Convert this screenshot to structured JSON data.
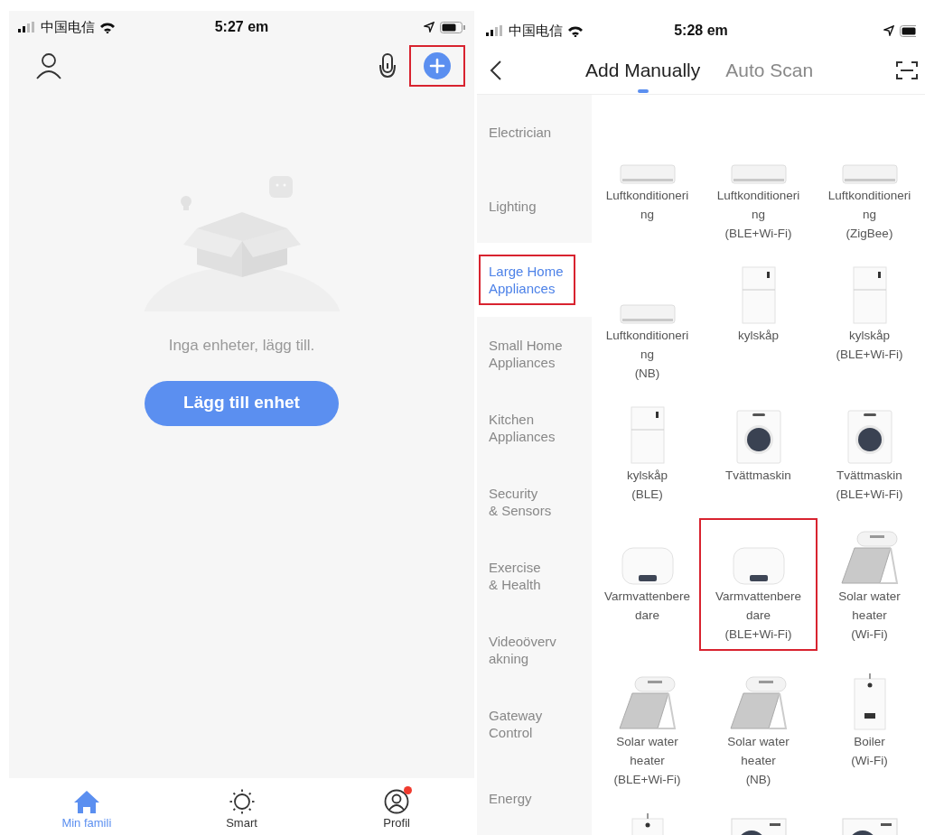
{
  "home_screen": {
    "status_bar": {
      "carrier": "中国电信",
      "time": "5:27 em"
    },
    "header": {
      "add_button_highlighted": true
    },
    "empty_state": {
      "message": "Inga enheter, lägg till.",
      "button": "Lägg till enhet"
    },
    "tab_bar": [
      {
        "kind": "home",
        "label": "Min famili",
        "selected": true,
        "badge": false
      },
      {
        "kind": "sun",
        "label": "Smart",
        "selected": false,
        "badge": false
      },
      {
        "kind": "profile",
        "label": "Profil",
        "selected": false,
        "badge": true
      }
    ]
  },
  "add_device_screen": {
    "status_bar": {
      "carrier": "中国电信",
      "time": "5:28 em"
    },
    "tabs": [
      {
        "label": "Add Manually",
        "selected": true
      },
      {
        "label": "Auto Scan",
        "selected": false
      }
    ],
    "categories": [
      {
        "label": "Electrician",
        "selected": false,
        "highlighted": false
      },
      {
        "label": "Lighting",
        "selected": false,
        "highlighted": false
      },
      {
        "label": "Large Home\nAppliances",
        "selected": true,
        "highlighted": true
      },
      {
        "label": "Small Home\nAppliances",
        "selected": false,
        "highlighted": false
      },
      {
        "label": "Kitchen\nAppliances",
        "selected": false,
        "highlighted": false
      },
      {
        "label": "Security\n& Sensors",
        "selected": false,
        "highlighted": false
      },
      {
        "label": "Exercise\n& Health",
        "selected": false,
        "highlighted": false
      },
      {
        "label": "Videoöverv\nakning",
        "selected": false,
        "highlighted": false
      },
      {
        "label": "Gateway\nControl",
        "selected": false,
        "highlighted": false
      },
      {
        "label": "Energy",
        "selected": false,
        "highlighted": false
      }
    ],
    "devices": [
      {
        "kind": "ac",
        "label": "Luftkonditioneri\nng",
        "highlighted": false
      },
      {
        "kind": "ac",
        "label": "Luftkonditioneri\nng\n(BLE+Wi-Fi)",
        "highlighted": false
      },
      {
        "kind": "ac",
        "label": "Luftkonditioneri\nng\n(ZigBee)",
        "highlighted": false
      },
      {
        "kind": "ac",
        "label": "Luftkonditioneri\nng\n(NB)",
        "highlighted": false
      },
      {
        "kind": "fridge",
        "label": "kylskåp",
        "highlighted": false
      },
      {
        "kind": "fridge",
        "label": "kylskåp\n(BLE+Wi-Fi)",
        "highlighted": false
      },
      {
        "kind": "fridge",
        "label": "kylskåp\n(BLE)",
        "highlighted": false
      },
      {
        "kind": "washer",
        "label": "Tvättmaskin",
        "highlighted": false
      },
      {
        "kind": "washer",
        "label": "Tvättmaskin\n(BLE+Wi-Fi)",
        "highlighted": false
      },
      {
        "kind": "water_heater",
        "label": "Varmvattenbere\ndare",
        "highlighted": false
      },
      {
        "kind": "water_heater",
        "label": "Varmvattenbere\ndare\n(BLE+Wi-Fi)",
        "highlighted": true
      },
      {
        "kind": "solar",
        "label": "Solar water\nheater\n(Wi-Fi)",
        "highlighted": false
      },
      {
        "kind": "solar",
        "label": "Solar water\nheater\n(BLE+Wi-Fi)",
        "highlighted": false
      },
      {
        "kind": "solar",
        "label": "Solar water\nheater\n(NB)",
        "highlighted": false
      },
      {
        "kind": "boiler",
        "label": "Boiler\n(Wi-Fi)",
        "highlighted": false
      },
      {
        "kind": "boiler",
        "highlighted": false
      },
      {
        "kind": "heat_pump",
        "highlighted": false
      },
      {
        "kind": "heat_pump",
        "highlighted": false
      }
    ]
  }
}
